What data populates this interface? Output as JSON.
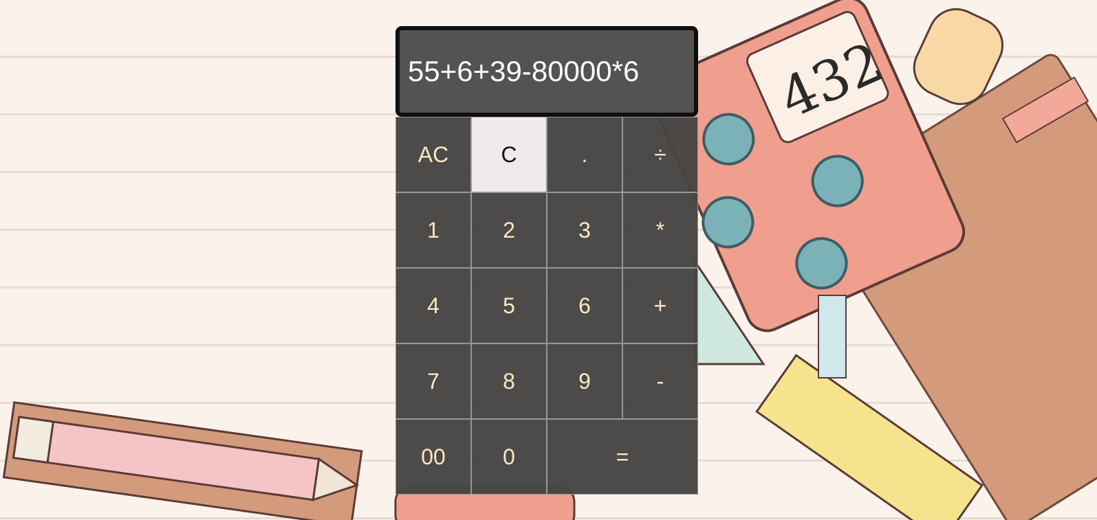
{
  "display": {
    "expression": "55+6+39-80000*6"
  },
  "keys": {
    "ac": "AC",
    "c": "C",
    "dot": ".",
    "divide": "÷",
    "one": "1",
    "two": "2",
    "three": "3",
    "multiply": "*",
    "four": "4",
    "five": "5",
    "six": "6",
    "plus": "+",
    "seven": "7",
    "eight": "8",
    "nine": "9",
    "minus": "-",
    "double_zero": "00",
    "zero": "0",
    "equals": "="
  },
  "colors": {
    "display_bg": "#555352",
    "key_bg": "#464442",
    "key_text": "#fbe7c4",
    "active_key_bg": "#eeebea",
    "page_bg": "#fbf2ec"
  },
  "background": {
    "illustration": {
      "calculator_screen_text": "432"
    }
  }
}
